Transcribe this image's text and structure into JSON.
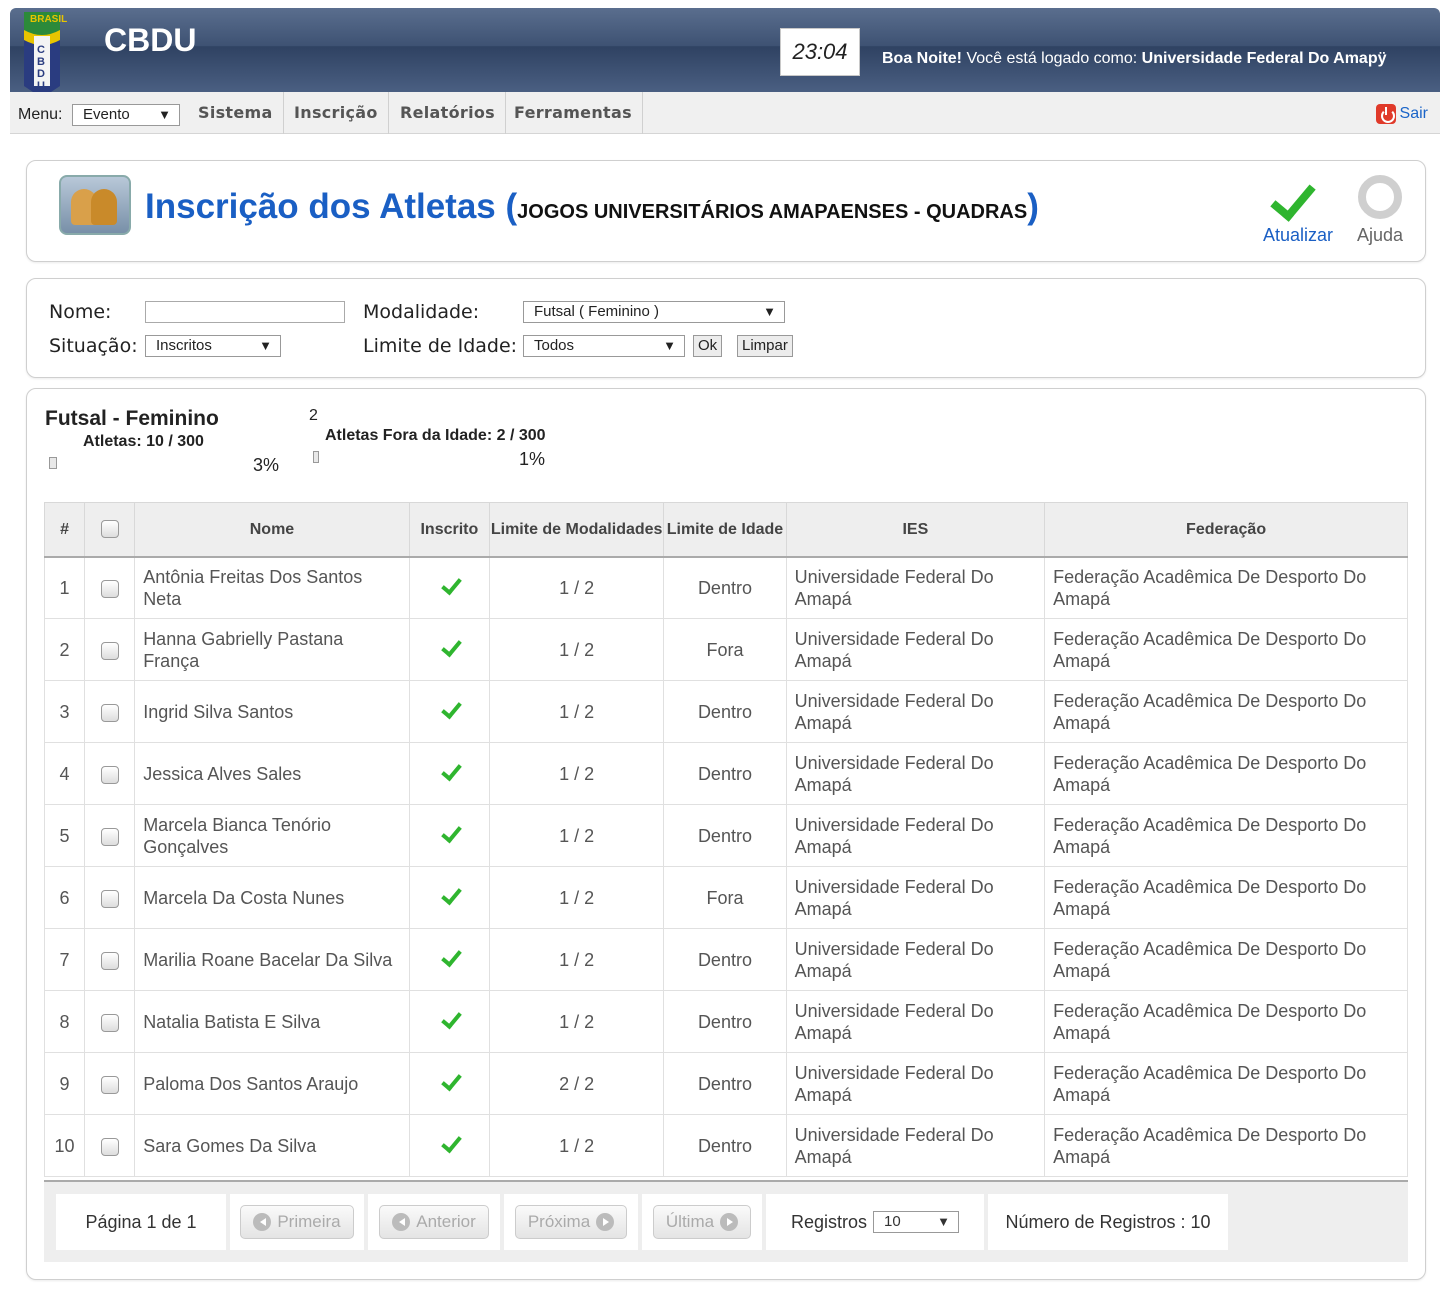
{
  "header": {
    "brand": "CBDU",
    "logo_text": "BRASIL",
    "logo_letters": "CBDU",
    "clock": "23:04",
    "greeting_bold": "Boa Noite!",
    "greeting_text": " Você está logado como: ",
    "user": "Universidade Federal Do Amapÿ"
  },
  "menubar": {
    "label": "Menu:",
    "select_value": "Evento",
    "items": [
      "Sistema",
      "Inscrição",
      "Relatórios",
      "Ferramentas"
    ],
    "logout": "Sair"
  },
  "title": {
    "main": "Inscrição dos Atletas ",
    "paren_open": "(",
    "event": "JOGOS UNIVERSITÁRIOS AMAPAENSES - QUADRAS",
    "paren_close": ")",
    "refresh": "Atualizar",
    "help": "Ajuda"
  },
  "filters": {
    "name_label": "Nome:",
    "name_value": "",
    "modality_label": "Modalidade:",
    "modality_value": "Futsal ( Feminino )",
    "status_label": "Situação:",
    "status_value": "Inscritos",
    "age_label": "Limite de Idade:",
    "age_value": "Todos",
    "ok": "Ok",
    "clear": "Limpar"
  },
  "stats": {
    "modality": "Futsal - Feminino",
    "athletes": "Atletas: 10 / 300",
    "athletes_pct": "3%",
    "athletes_fraction": 0.03,
    "out_count": "2",
    "out_age": "Atletas Fora da Idade: 2 / 300",
    "out_pct": "1%",
    "out_fraction": 0.01
  },
  "table": {
    "headers": [
      "#",
      "",
      "Nome",
      "Inscrito",
      "Limite de Modalidades",
      "Limite de Idade",
      "IES",
      "Federação"
    ],
    "rows": [
      {
        "n": "1",
        "name": "Antônia Freitas Dos Santos Neta",
        "limit": "1 / 2",
        "age": "Dentro",
        "ies": "Universidade Federal Do Amapá",
        "fed": "Federação Acadêmica De Desporto Do Amapá"
      },
      {
        "n": "2",
        "name": "Hanna Gabrielly Pastana França",
        "limit": "1 / 2",
        "age": "Fora",
        "ies": "Universidade Federal Do Amapá",
        "fed": "Federação Acadêmica De Desporto Do Amapá"
      },
      {
        "n": "3",
        "name": "Ingrid Silva Santos",
        "limit": "1 / 2",
        "age": "Dentro",
        "ies": "Universidade Federal Do Amapá",
        "fed": "Federação Acadêmica De Desporto Do Amapá"
      },
      {
        "n": "4",
        "name": "Jessica Alves Sales",
        "limit": "1 / 2",
        "age": "Dentro",
        "ies": "Universidade Federal Do Amapá",
        "fed": "Federação Acadêmica De Desporto Do Amapá"
      },
      {
        "n": "5",
        "name": "Marcela Bianca Tenório Gonçalves",
        "limit": "1 / 2",
        "age": "Dentro",
        "ies": "Universidade Federal Do Amapá",
        "fed": "Federação Acadêmica De Desporto Do Amapá"
      },
      {
        "n": "6",
        "name": "Marcela Da Costa Nunes",
        "limit": "1 / 2",
        "age": "Fora",
        "ies": "Universidade Federal Do Amapá",
        "fed": "Federação Acadêmica De Desporto Do Amapá"
      },
      {
        "n": "7",
        "name": "Marilia Roane Bacelar Da Silva",
        "limit": "1 / 2",
        "age": "Dentro",
        "ies": "Universidade Federal Do Amapá",
        "fed": "Federação Acadêmica De Desporto Do Amapá"
      },
      {
        "n": "8",
        "name": "Natalia Batista E Silva",
        "limit": "1 / 2",
        "age": "Dentro",
        "ies": "Universidade Federal Do Amapá",
        "fed": "Federação Acadêmica De Desporto Do Amapá"
      },
      {
        "n": "9",
        "name": "Paloma Dos Santos Araujo",
        "limit": "2 / 2",
        "age": "Dentro",
        "ies": "Universidade Federal Do Amapá",
        "fed": "Federação Acadêmica De Desporto Do Amapá"
      },
      {
        "n": "10",
        "name": "Sara Gomes Da Silva",
        "limit": "1 / 2",
        "age": "Dentro",
        "ies": "Universidade Federal Do Amapá",
        "fed": "Federação Acadêmica De Desporto Do Amapá"
      }
    ]
  },
  "pager": {
    "page": "Página 1 de 1",
    "first": "Primeira",
    "prev": "Anterior",
    "next": "Próxima",
    "last": "Última",
    "records_label": "Registros",
    "records_value": "10",
    "total": "Número de Registros : 10"
  },
  "icons": {
    "logout": "power-icon",
    "refresh": "check-icon",
    "help": "lifebuoy-icon",
    "title": "people-icon"
  },
  "colors": {
    "accent": "#1a5fc4",
    "header": "#3e5273",
    "check": "#2fb52f"
  }
}
